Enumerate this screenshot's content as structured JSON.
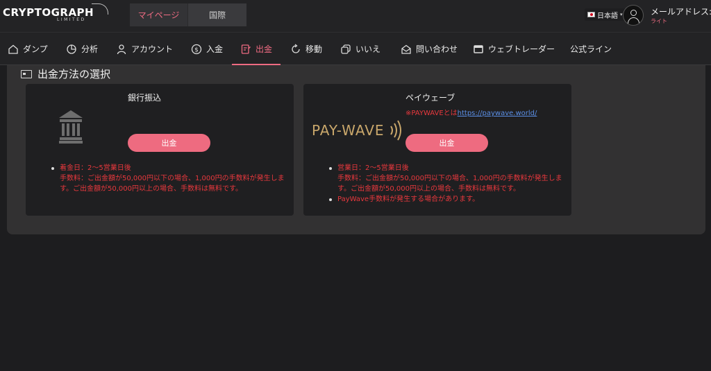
{
  "header": {
    "logo_main": "CRYPTOGRAPH",
    "logo_sub": "LIMITED",
    "tabs": [
      {
        "label": "マイページ",
        "active": true
      },
      {
        "label": "国際",
        "active": false
      }
    ],
    "language": "日本語",
    "user_label": "メールアドレス:",
    "user_plan": "ライト"
  },
  "nav": {
    "items": [
      {
        "label": "ダンプ",
        "icon": "home-icon"
      },
      {
        "label": "分析",
        "icon": "pie-chart-icon"
      },
      {
        "label": "アカウント",
        "icon": "user-icon"
      },
      {
        "label": "入金",
        "icon": "coin-icon"
      },
      {
        "label": "出金",
        "icon": "withdraw-icon",
        "active": true
      },
      {
        "label": "移動",
        "icon": "refresh-icon"
      },
      {
        "label": "いいえ",
        "icon": "copy-icon"
      },
      {
        "label": "問い合わせ",
        "icon": "mail-open-icon"
      },
      {
        "label": "ウェブトレーダー",
        "icon": "window-icon"
      },
      {
        "label": "公式ライン",
        "icon": ""
      }
    ]
  },
  "main": {
    "section_title": "出金方法の選択",
    "cards": [
      {
        "title": "銀行振込",
        "button": "出金",
        "bullets": [
          {
            "text": "着金日：2〜5営業日後",
            "bullet": true
          },
          {
            "text": "手数料：ご出金額が50,000円以下の場合、1,000円の手数料が発生します。ご出金額が50,000円以上の場合、手数料は無料です。",
            "bullet": false
          }
        ]
      },
      {
        "title": "ペイウェーブ",
        "note_prefix": "※PAYWAVEとは",
        "note_link": "https://paywave.world/",
        "logo_text": "PAY-WAVE",
        "button": "出金",
        "bullets": [
          {
            "text": "営業日：2〜5営業日後",
            "bullet": true
          },
          {
            "text": "手数料：ご出金額が50,000円以下の場合、1,000円の手数料が発生します。ご出金額が50,000円以上の場合、手数料は無料です。",
            "bullet": false
          },
          {
            "text": "PayWave手数料が発生する場合があります。",
            "bullet": true
          }
        ]
      }
    ]
  },
  "colors": {
    "accent": "#ee6b80",
    "warning_text": "#e8383d",
    "link": "#5b8fe6",
    "paywave_gold": "#c9a76b"
  }
}
